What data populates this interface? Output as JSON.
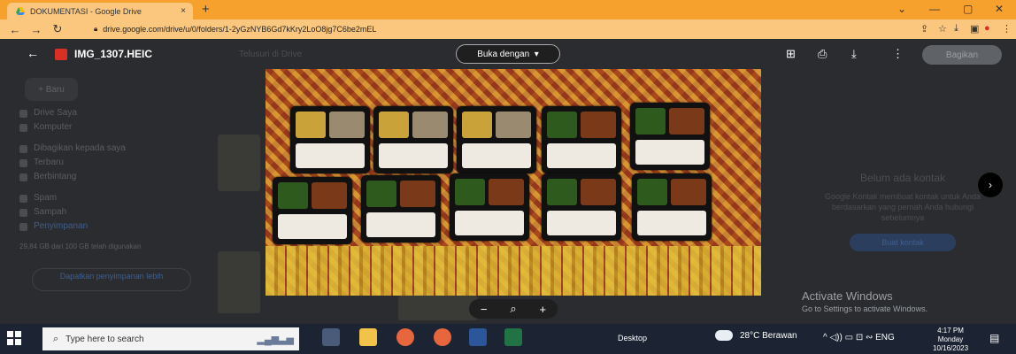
{
  "browser": {
    "tab_title": "DOKUMENTASI - Google Drive",
    "tab_close": "×",
    "new_tab": "+",
    "url": "drive.google.com/drive/u/0/folders/1-2yGzNYB6Gd7kKry2LoO8jg7C6be2mEL",
    "win_min": "—",
    "win_max": "▢",
    "win_close": "✕",
    "win_chevron": "⌄"
  },
  "drive_bg": {
    "new_label": "Baru",
    "sidebar_items": [
      "Drive Saya",
      "Komputer",
      "Dibagikan kepada saya",
      "Terbaru",
      "Berbintang",
      "Spam",
      "Sampah",
      "Penyimpanan"
    ],
    "storage_text": "29,84 GB dari 100 GB telah digunakan",
    "storage_button": "Dapatkan penyimpanan lebih",
    "search_placeholder": "Telusuri di Drive",
    "contact_title": "Belum ada kontak",
    "contact_desc": "Google Kontak membuat kontak untuk Anda berdasarkan yang pernah Anda hubungi sebelumnya",
    "contact_button": "Buat kontak"
  },
  "viewer": {
    "back_icon": "arrow-left-icon",
    "file_name": "IMG_1307.HEIC",
    "open_with_label": "Buka dengan",
    "share_label": "Bagikan",
    "zoom_out": "−",
    "zoom_icon": "⌕",
    "zoom_in": "+",
    "next_arrow": "›"
  },
  "windows": {
    "activate_title": "Activate Windows",
    "activate_sub": "Go to Settings to activate Windows."
  },
  "taskbar": {
    "search_placeholder": "Type here to search",
    "desktop_label": "Desktop",
    "weather": "28°C  Berawan",
    "tray": "^  ◁))  ▭  ⊡  ∾  ENG",
    "time": "4:17 PM",
    "day": "Monday",
    "date": "10/16/2023"
  },
  "colors": {
    "chrome_tabbar": "#f6a02d",
    "chrome_toolbar": "#fbc77f",
    "viewer_bg": "#202124",
    "taskbar": "#1c2433"
  }
}
